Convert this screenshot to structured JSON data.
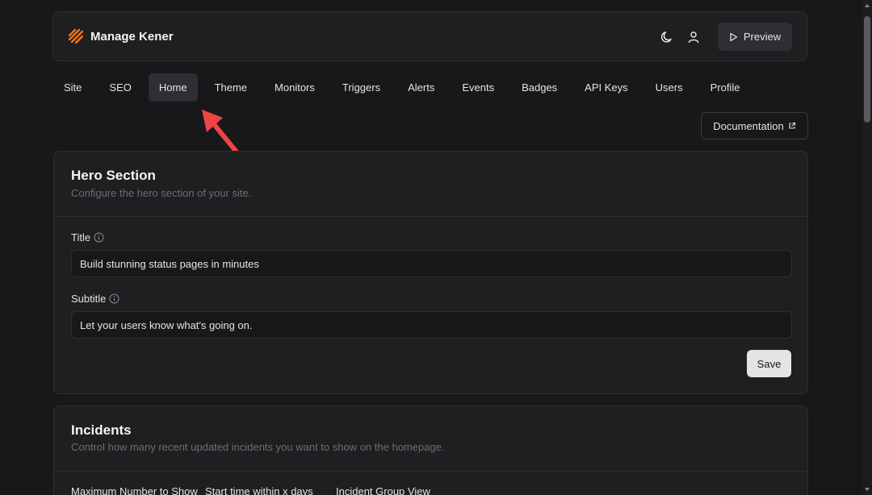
{
  "header": {
    "title": "Manage Kener",
    "preview_label": "Preview",
    "brand_color": "#f97316"
  },
  "tabs": [
    {
      "label": "Site"
    },
    {
      "label": "SEO"
    },
    {
      "label": "Home",
      "active": true
    },
    {
      "label": "Theme"
    },
    {
      "label": "Monitors"
    },
    {
      "label": "Triggers"
    },
    {
      "label": "Alerts"
    },
    {
      "label": "Events"
    },
    {
      "label": "Badges"
    },
    {
      "label": "API Keys"
    },
    {
      "label": "Users"
    },
    {
      "label": "Profile"
    }
  ],
  "documentation_label": "Documentation",
  "hero": {
    "title": "Hero Section",
    "description": "Configure the hero section of your site.",
    "title_label": "Title",
    "title_value": "Build stunning status pages in minutes",
    "subtitle_label": "Subtitle",
    "subtitle_value": "Let your users know what's going on.",
    "save_label": "Save"
  },
  "incidents": {
    "title": "Incidents",
    "description": "Control how many recent updated incidents you want to show on the homepage.",
    "col1_label": "Maximum Number to Show",
    "col2_label": "Start time within x days",
    "col3_label": "Incident Group View"
  },
  "annotation": {
    "arrow_color": "#ef4444"
  }
}
